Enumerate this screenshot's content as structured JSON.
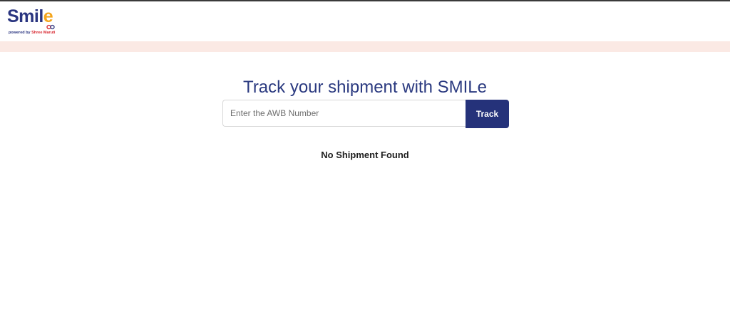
{
  "header": {
    "logo": {
      "word_main": "Smil",
      "word_last": "e",
      "tagline_prefix": "powered by",
      "tagline_brand": "Shree Maruti",
      "colors": {
        "primary": "#2a3580",
        "accent": "#f4a51c",
        "brand_red": "#d8262f"
      }
    }
  },
  "band": {
    "color": "#fbe9e4"
  },
  "main": {
    "title": "Track your shipment with SMILe",
    "search": {
      "placeholder": "Enter the AWB Number",
      "value": ""
    },
    "track_button_label": "Track",
    "status_message": "No Shipment Found"
  },
  "colors": {
    "title": "#2b3a80",
    "button_bg": "#25327a",
    "button_text": "#ffffff"
  }
}
